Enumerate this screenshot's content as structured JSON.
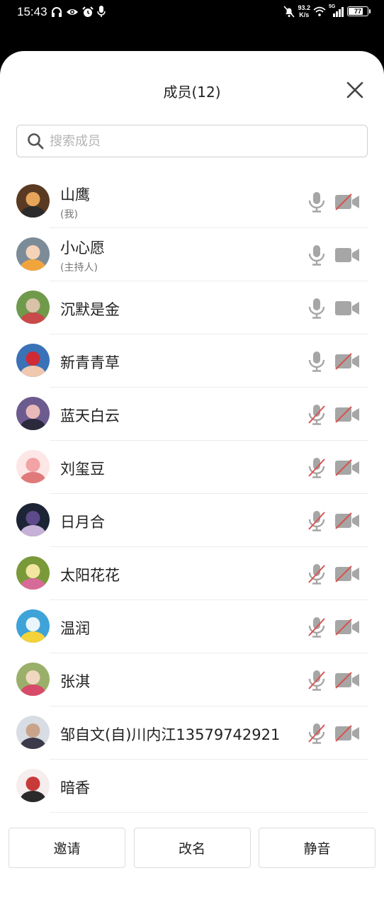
{
  "status_bar": {
    "time": "15:43",
    "net_speed_value": "93.2",
    "net_speed_unit": "K/s",
    "network_type": "5G",
    "battery": "77"
  },
  "sheet": {
    "title": "成员(12)",
    "search_placeholder": "搜索成员"
  },
  "members": [
    {
      "name": "山鹰",
      "role": "(我)",
      "mic": "on",
      "camera": "off",
      "avatar_colors": [
        "#5a3a22",
        "#e6a55a",
        "#2b2b2b"
      ]
    },
    {
      "name": "小心愿",
      "role": "(主持人)",
      "mic": "on",
      "camera": "on",
      "avatar_colors": [
        "#7c8b98",
        "#f5d3b8",
        "#f2a43c"
      ]
    },
    {
      "name": "沉默是金",
      "role": "",
      "mic": "on",
      "camera": "on",
      "avatar_colors": [
        "#6f9a4c",
        "#d8c2a8",
        "#c84a4a"
      ]
    },
    {
      "name": "新青青草",
      "role": "",
      "mic": "on",
      "camera": "off",
      "avatar_colors": [
        "#3a72b8",
        "#d02a34",
        "#f0c8b0"
      ]
    },
    {
      "name": "蓝天白云",
      "role": "",
      "mic": "off",
      "camera": "off",
      "avatar_colors": [
        "#6b5b8f",
        "#e9b8b8",
        "#2a2a3c"
      ]
    },
    {
      "name": "刘玺豆",
      "role": "",
      "mic": "off",
      "camera": "off",
      "avatar_colors": [
        "#fde6e6",
        "#f2a3a3",
        "#e07a7a"
      ]
    },
    {
      "name": "日月合",
      "role": "",
      "mic": "off",
      "camera": "off",
      "avatar_colors": [
        "#1c2436",
        "#5c4a8a",
        "#c6b2d8"
      ]
    },
    {
      "name": "太阳花花",
      "role": "",
      "mic": "off",
      "camera": "off",
      "avatar_colors": [
        "#7a9a3a",
        "#f3e6a0",
        "#d86a9a"
      ]
    },
    {
      "name": "温润",
      "role": "",
      "mic": "off",
      "camera": "off",
      "avatar_colors": [
        "#3ea3d8",
        "#eaf6fb",
        "#f3d23a"
      ]
    },
    {
      "name": "张淇",
      "role": "",
      "mic": "off",
      "camera": "off",
      "avatar_colors": [
        "#9ab06a",
        "#f0d8c0",
        "#d84a6a"
      ]
    },
    {
      "name": "邹自文(自)川内江13579742921",
      "role": "",
      "mic": "off",
      "camera": "off",
      "avatar_colors": [
        "#d8dde4",
        "#c9a48a",
        "#3a3a4a"
      ]
    },
    {
      "name": "暗香",
      "role": "",
      "mic": "none",
      "camera": "none",
      "avatar_colors": [
        "#f6eeee",
        "#c83a3a",
        "#2a2a2a"
      ]
    }
  ],
  "actions": {
    "invite": "邀请",
    "rename": "改名",
    "mute": "静音"
  },
  "colors": {
    "icon_gray": "#a6a6a6",
    "off_slash_red": "#d9534f",
    "text": "#222222"
  }
}
